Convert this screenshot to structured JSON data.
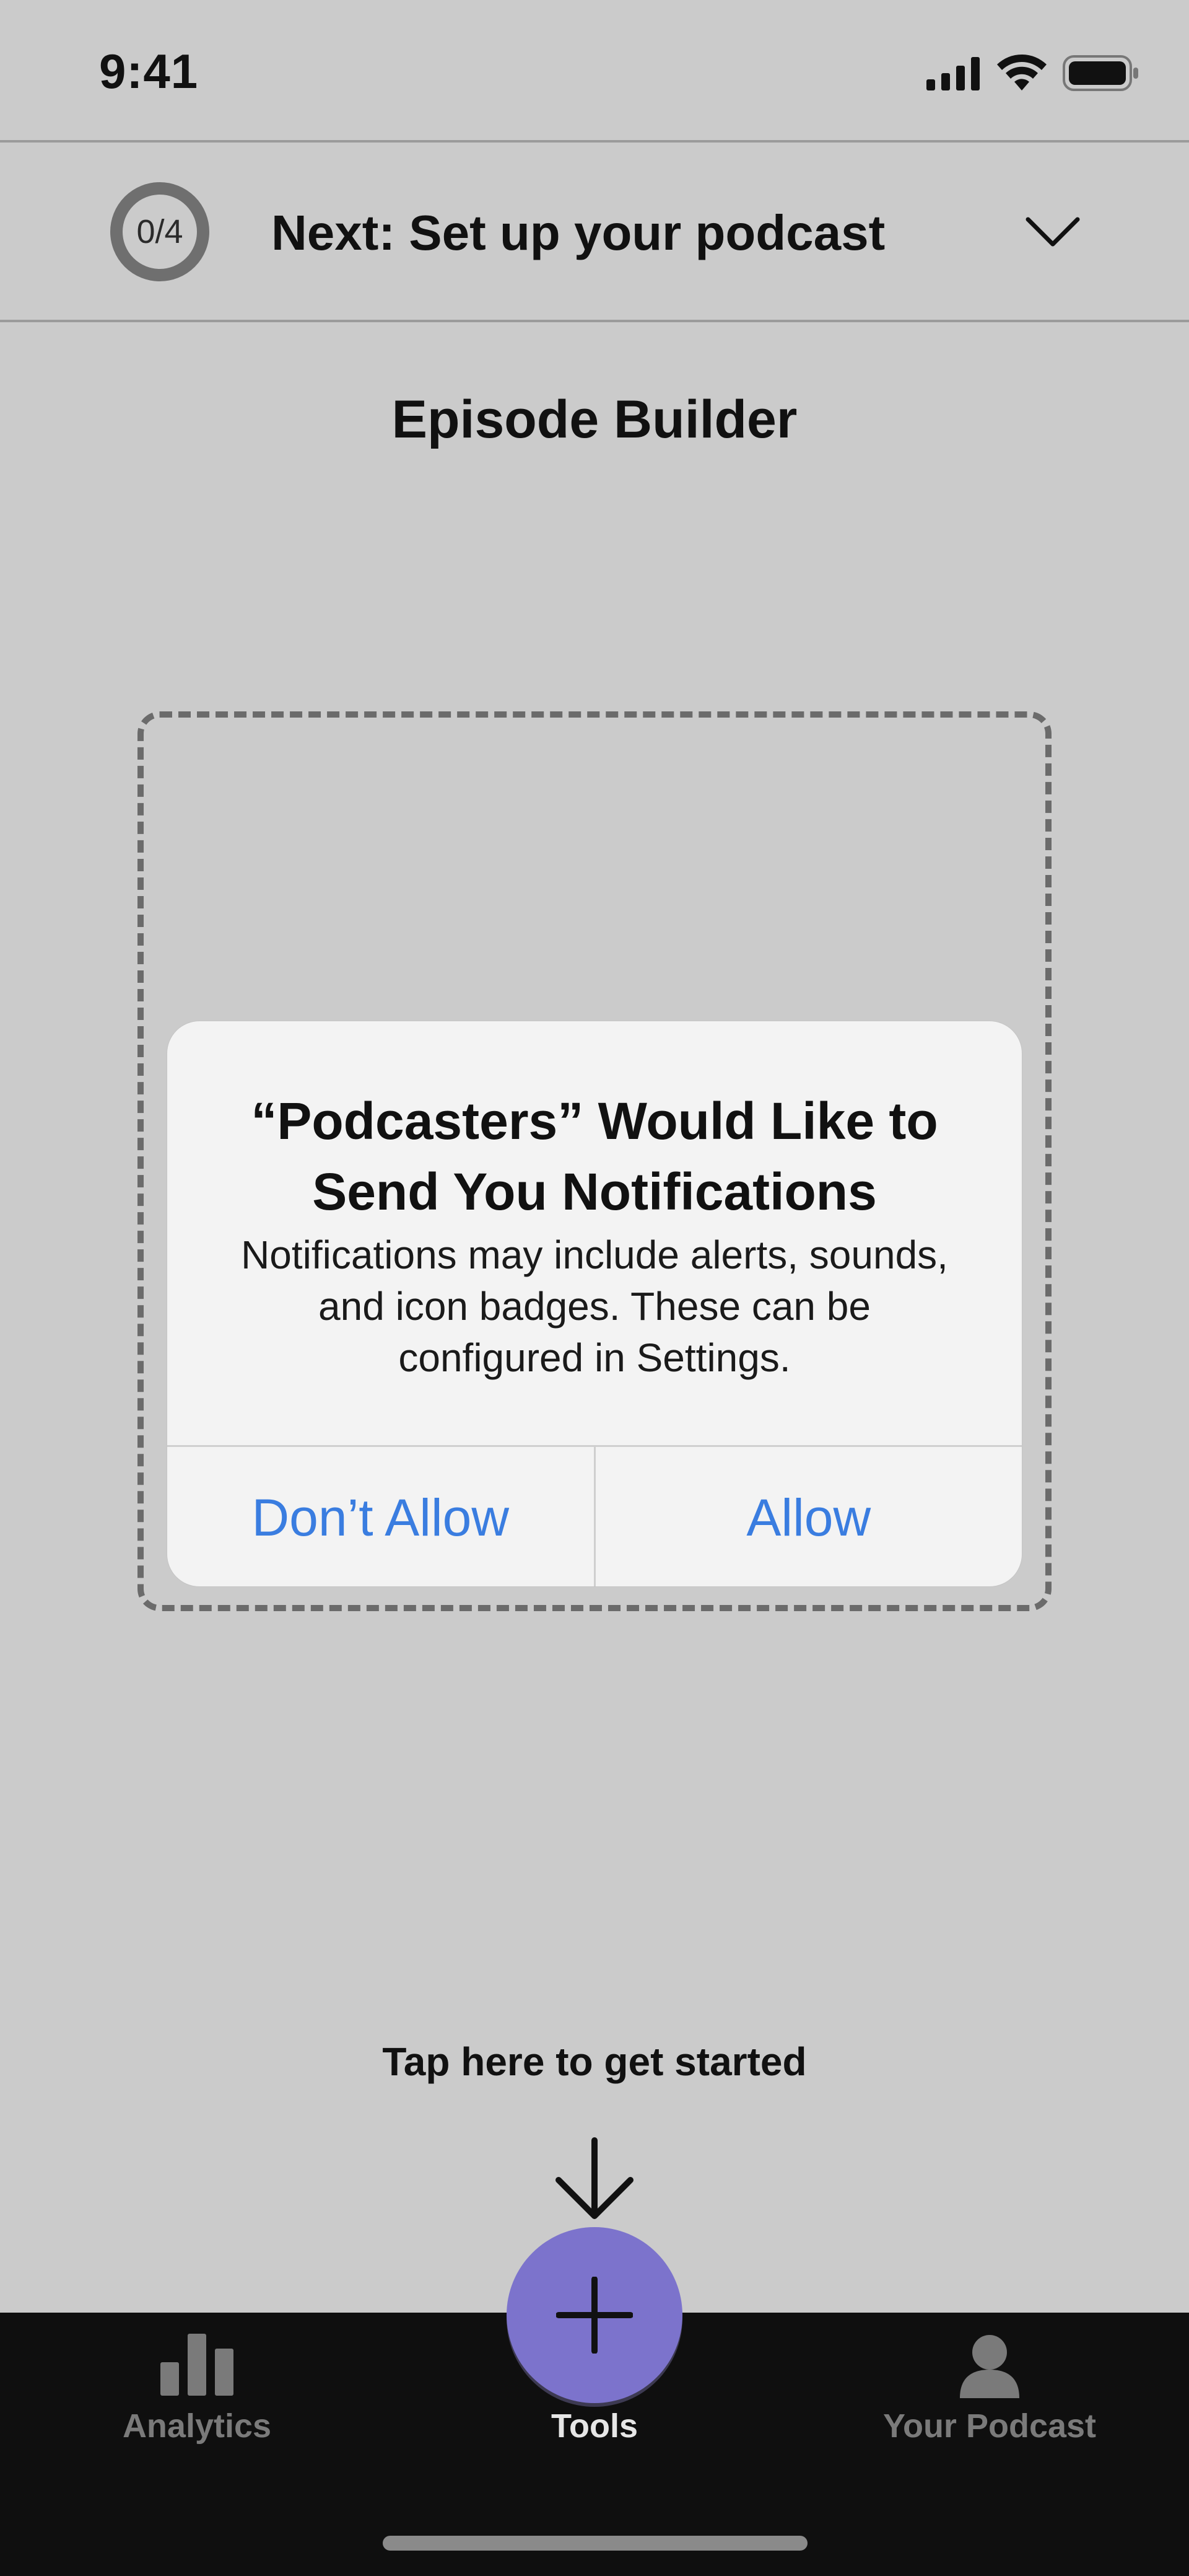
{
  "status_bar": {
    "time": "9:41",
    "icons": [
      "signal-icon",
      "wifi-icon",
      "battery-icon"
    ]
  },
  "onboarding": {
    "progress": "0/4",
    "title": "Next: Set up your podcast",
    "expand_icon": "chevron-down-icon"
  },
  "page": {
    "title": "Episode Builder"
  },
  "alert": {
    "title": "“Podcasters” Would Like to Send You Notifications",
    "message": "Notifications may include alerts, sounds, and icon badges. These can be configured in Settings.",
    "deny_label": "Don’t Allow",
    "allow_label": "Allow"
  },
  "hint": {
    "text": "Tap here to get started",
    "icon": "arrow-down-icon"
  },
  "tab_bar": {
    "items": [
      {
        "label": "Analytics",
        "icon": "bar-chart-icon",
        "active": false
      },
      {
        "label": "Tools",
        "icon": "plus-icon",
        "active": true
      },
      {
        "label": "Your Podcast",
        "icon": "person-icon",
        "active": false
      }
    ]
  },
  "colors": {
    "background": "#cbcbcb",
    "accent": "#7c73cc",
    "link": "#3a7de0",
    "tab_bar": "#0f0f0f"
  }
}
